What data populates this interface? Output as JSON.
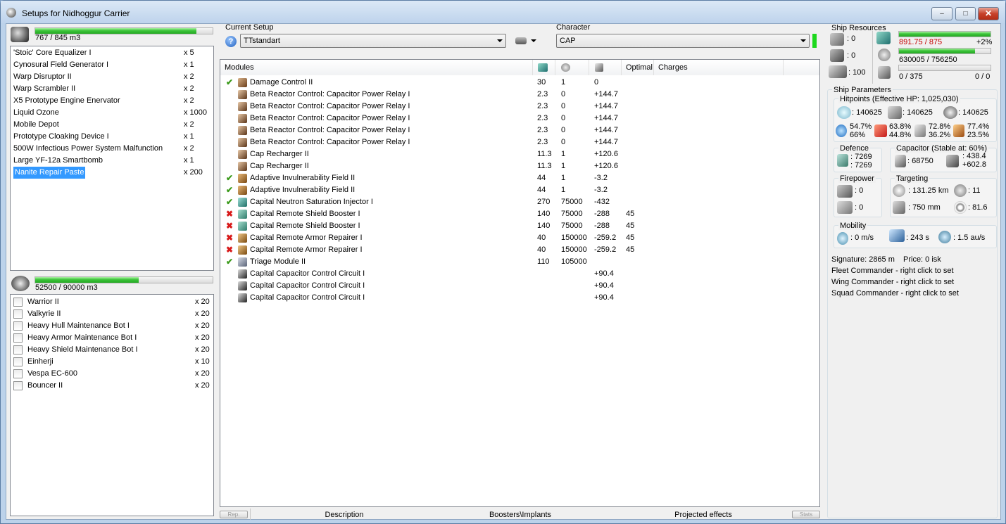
{
  "window": {
    "title": "Setups for Nidhoggur Carrier"
  },
  "cargo": {
    "capacity": "767 / 845 m3",
    "fill": 0.908,
    "items": [
      {
        "name": "'Stoic' Core Equalizer I",
        "qty": "x 5"
      },
      {
        "name": "Cynosural Field Generator I",
        "qty": "x 1"
      },
      {
        "name": "Warp Disruptor II",
        "qty": "x 2"
      },
      {
        "name": "Warp Scrambler II",
        "qty": "x 2"
      },
      {
        "name": "X5 Prototype Engine Enervator",
        "qty": "x 2"
      },
      {
        "name": "Liquid Ozone",
        "qty": "x 1000"
      },
      {
        "name": "Mobile Depot",
        "qty": "x 2"
      },
      {
        "name": "Prototype Cloaking Device I",
        "qty": "x 1"
      },
      {
        "name": "500W Infectious Power System Malfunction",
        "qty": "x 2"
      },
      {
        "name": "Large YF-12a Smartbomb",
        "qty": "x 1"
      },
      {
        "name": "Nanite Repair Paste",
        "qty": "x 200"
      }
    ]
  },
  "drones": {
    "capacity": "52500 / 90000 m3",
    "fill": 0.583,
    "items": [
      {
        "name": "Warrior II",
        "qty": "x 20"
      },
      {
        "name": "Valkyrie II",
        "qty": "x 20"
      },
      {
        "name": "Heavy Hull Maintenance Bot I",
        "qty": "x 20"
      },
      {
        "name": "Heavy Armor Maintenance Bot I",
        "qty": "x 20"
      },
      {
        "name": "Heavy Shield Maintenance Bot I",
        "qty": "x 20"
      },
      {
        "name": "Einherji",
        "qty": "x 10"
      },
      {
        "name": "Vespa EC-600",
        "qty": "x 20"
      },
      {
        "name": "Bouncer II",
        "qty": "x 20"
      }
    ]
  },
  "setup": {
    "label": "Current Setup",
    "value": "TTstandart"
  },
  "character": {
    "label": "Character",
    "value": "CAP"
  },
  "modules": {
    "headers": {
      "name": "Modules",
      "optimal": "Optimal",
      "charges": "Charges"
    },
    "rows": [
      {
        "status": "ok",
        "icon": "damage-control-icon",
        "name": "Damage Control II",
        "cpu": "30",
        "pg": "1",
        "cap": "0",
        "optimal": ""
      },
      {
        "status": "",
        "icon": "rig-icon",
        "name": "Beta Reactor Control: Capacitor Power Relay I",
        "cpu": "2.3",
        "pg": "0",
        "cap": "+144.7",
        "optimal": ""
      },
      {
        "status": "",
        "icon": "rig-icon",
        "name": "Beta Reactor Control: Capacitor Power Relay I",
        "cpu": "2.3",
        "pg": "0",
        "cap": "+144.7",
        "optimal": ""
      },
      {
        "status": "",
        "icon": "rig-icon",
        "name": "Beta Reactor Control: Capacitor Power Relay I",
        "cpu": "2.3",
        "pg": "0",
        "cap": "+144.7",
        "optimal": ""
      },
      {
        "status": "",
        "icon": "rig-icon",
        "name": "Beta Reactor Control: Capacitor Power Relay I",
        "cpu": "2.3",
        "pg": "0",
        "cap": "+144.7",
        "optimal": ""
      },
      {
        "status": "",
        "icon": "rig-icon",
        "name": "Beta Reactor Control: Capacitor Power Relay I",
        "cpu": "2.3",
        "pg": "0",
        "cap": "+144.7",
        "optimal": ""
      },
      {
        "status": "",
        "icon": "rig-icon",
        "name": "Cap Recharger II",
        "cpu": "11.3",
        "pg": "1",
        "cap": "+120.6",
        "optimal": ""
      },
      {
        "status": "",
        "icon": "rig-icon",
        "name": "Cap Recharger II",
        "cpu": "11.3",
        "pg": "1",
        "cap": "+120.6",
        "optimal": ""
      },
      {
        "status": "ok",
        "icon": "shield-hardener-icon",
        "name": "Adaptive Invulnerability Field II",
        "cpu": "44",
        "pg": "1",
        "cap": "-3.2",
        "optimal": ""
      },
      {
        "status": "ok",
        "icon": "shield-hardener-icon",
        "name": "Adaptive Invulnerability Field II",
        "cpu": "44",
        "pg": "1",
        "cap": "-3.2",
        "optimal": ""
      },
      {
        "status": "ok",
        "icon": "neutralizer-icon",
        "name": "Capital Neutron Saturation Injector I",
        "cpu": "270",
        "pg": "75000",
        "cap": "-432",
        "optimal": ""
      },
      {
        "status": "off",
        "icon": "shield-booster-icon",
        "name": "Capital Remote Shield Booster I",
        "cpu": "140",
        "pg": "75000",
        "cap": "-288",
        "optimal": "45"
      },
      {
        "status": "off",
        "icon": "shield-booster-icon",
        "name": "Capital Remote Shield Booster I",
        "cpu": "140",
        "pg": "75000",
        "cap": "-288",
        "optimal": "45"
      },
      {
        "status": "off",
        "icon": "armor-repairer-icon",
        "name": "Capital Remote Armor Repairer I",
        "cpu": "40",
        "pg": "150000",
        "cap": "-259.2",
        "optimal": "45"
      },
      {
        "status": "off",
        "icon": "armor-repairer-icon",
        "name": "Capital Remote Armor Repairer I",
        "cpu": "40",
        "pg": "150000",
        "cap": "-259.2",
        "optimal": "45"
      },
      {
        "status": "ok",
        "icon": "triage-icon",
        "name": "Triage Module II",
        "cpu": "110",
        "pg": "105000",
        "cap": "",
        "optimal": ""
      },
      {
        "status": "",
        "icon": "circuit-icon",
        "name": "Capital Capacitor Control Circuit I",
        "cpu": "",
        "pg": "",
        "cap": "+90.4",
        "optimal": ""
      },
      {
        "status": "",
        "icon": "circuit-icon",
        "name": "Capital Capacitor Control Circuit I",
        "cpu": "",
        "pg": "",
        "cap": "+90.4",
        "optimal": ""
      },
      {
        "status": "",
        "icon": "circuit-icon",
        "name": "Capital Capacitor Control Circuit I",
        "cpu": "",
        "pg": "",
        "cap": "+90.4",
        "optimal": ""
      }
    ]
  },
  "bottom_tabs": {
    "left_btn": "Rep.",
    "description": "Description",
    "boosters": "Boosters\\Implants",
    "projected": "Projected effects",
    "right_btn": "Stats"
  },
  "resources": {
    "title": "Ship Resources",
    "hi": ": 0",
    "med": ": 0",
    "low": ": 100",
    "cpu": "891.75 / 875",
    "cpu_pct": "+2%",
    "cpu_fill": 1.0,
    "pg": "630005 / 756250",
    "pg_fill": 0.833,
    "calib": "0 / 375",
    "calib_right": "0 / 0",
    "calib_fill": 0.0
  },
  "params": {
    "title": "Ship Parameters",
    "hp_title": "Hitpoints (Effective HP: 1,025,030)",
    "shield_hp": ": 140625",
    "armor_hp": ": 140625",
    "hull_hp": ": 140625",
    "res": [
      {
        "a": "54.7%",
        "b": "66%"
      },
      {
        "a": "63.8%",
        "b": "44.8%"
      },
      {
        "a": "72.8%",
        "b": "36.2%"
      },
      {
        "a": "77.4%",
        "b": "23.5%"
      }
    ],
    "defence_title": "Defence",
    "def_a": ": 7269",
    "def_b": ": 7269",
    "cap_title": "Capacitor (Stable at: 60%)",
    "cap_amount": ": 68750",
    "cap_a": ": 438.4",
    "cap_b": "+602.8",
    "fire_title": "Firepower",
    "fire_a": ": 0",
    "fire_b": ": 0",
    "target_title": "Targeting",
    "range": ": 131.25 km",
    "targets": ": 11",
    "scan": ": 750 mm",
    "sensor": ": 81.6",
    "mobility_title": "Mobility",
    "speed": ": 0 m/s",
    "align": ": 243 s",
    "warp": ": 1.5 au/s",
    "signature": "Signature: 2865 m",
    "price": "Price: 0 isk",
    "fleet": "Fleet Commander - right click to set",
    "wing": "Wing Commander - right click to set",
    "squad": "Squad Commander - right click to set"
  },
  "colors": {
    "accent": "#3399ff",
    "ok": "#3a9a1a",
    "bad": "#d81b1b",
    "over": "#c40000",
    "bar": "#3cc43a"
  }
}
